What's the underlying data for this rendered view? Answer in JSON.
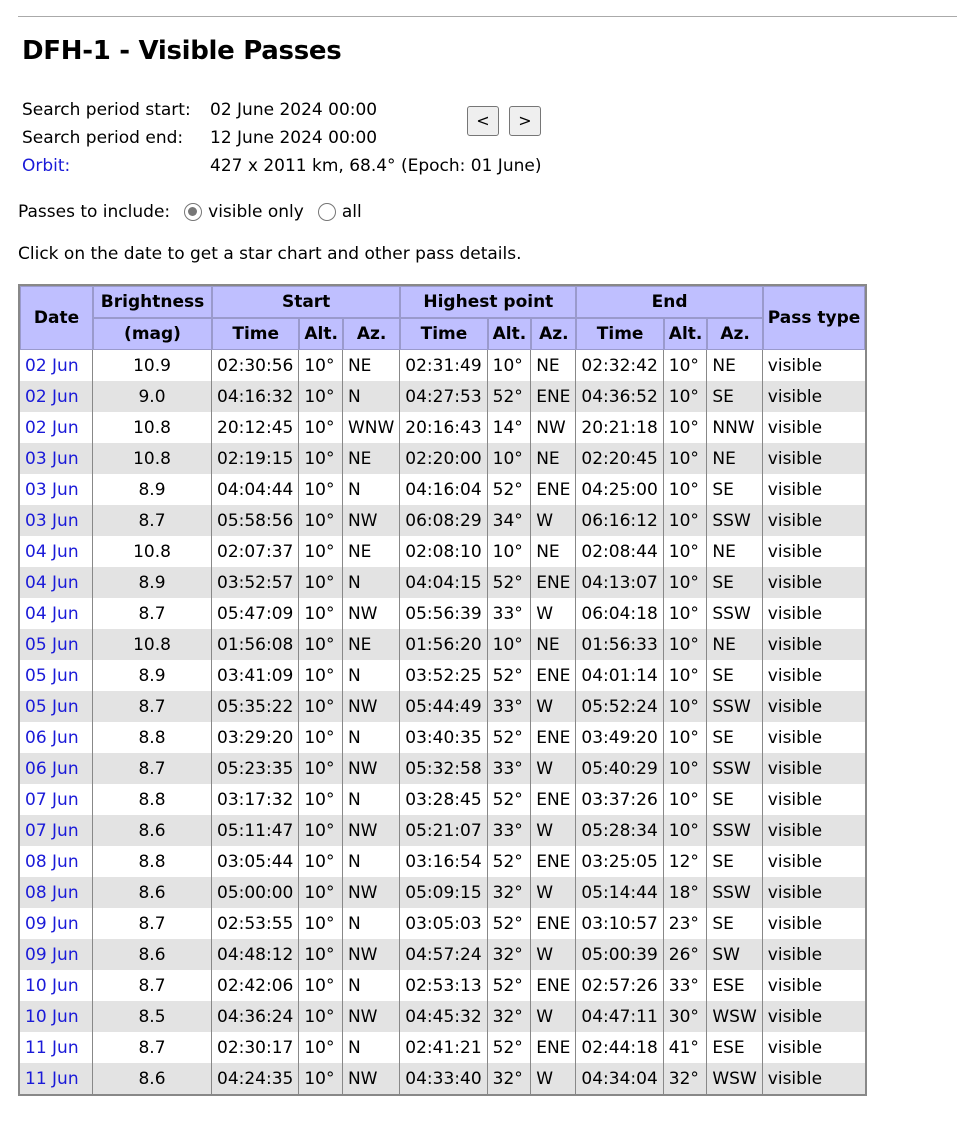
{
  "title": "DFH-1 - Visible Passes",
  "search": {
    "start_label": "Search period start:",
    "start_value": "02 June 2024 00:00",
    "end_label": "Search period end:",
    "end_value": "12 June 2024 00:00",
    "orbit_label": "Orbit:",
    "orbit_value": "427 x 2011 km, 68.4° (Epoch: 01 June)",
    "prev_button": "<",
    "next_button": ">"
  },
  "filter": {
    "label": "Passes to include:",
    "option_visible": "visible only",
    "option_all": "all",
    "selected": "visible only"
  },
  "hint": "Click on the date to get a star chart and other pass details.",
  "table": {
    "headers": {
      "date": "Date",
      "brightness": "Brightness",
      "mag": "(mag)",
      "start": "Start",
      "highest": "Highest point",
      "end": "End",
      "pass_type": "Pass type",
      "time": "Time",
      "alt": "Alt.",
      "az": "Az."
    },
    "rows": [
      [
        "02 Jun",
        "10.9",
        "02:30:56",
        "10°",
        "NE",
        "02:31:49",
        "10°",
        "NE",
        "02:32:42",
        "10°",
        "NE",
        "visible"
      ],
      [
        "02 Jun",
        "9.0",
        "04:16:32",
        "10°",
        "N",
        "04:27:53",
        "52°",
        "ENE",
        "04:36:52",
        "10°",
        "SE",
        "visible"
      ],
      [
        "02 Jun",
        "10.8",
        "20:12:45",
        "10°",
        "WNW",
        "20:16:43",
        "14°",
        "NW",
        "20:21:18",
        "10°",
        "NNW",
        "visible"
      ],
      [
        "03 Jun",
        "10.8",
        "02:19:15",
        "10°",
        "NE",
        "02:20:00",
        "10°",
        "NE",
        "02:20:45",
        "10°",
        "NE",
        "visible"
      ],
      [
        "03 Jun",
        "8.9",
        "04:04:44",
        "10°",
        "N",
        "04:16:04",
        "52°",
        "ENE",
        "04:25:00",
        "10°",
        "SE",
        "visible"
      ],
      [
        "03 Jun",
        "8.7",
        "05:58:56",
        "10°",
        "NW",
        "06:08:29",
        "34°",
        "W",
        "06:16:12",
        "10°",
        "SSW",
        "visible"
      ],
      [
        "04 Jun",
        "10.8",
        "02:07:37",
        "10°",
        "NE",
        "02:08:10",
        "10°",
        "NE",
        "02:08:44",
        "10°",
        "NE",
        "visible"
      ],
      [
        "04 Jun",
        "8.9",
        "03:52:57",
        "10°",
        "N",
        "04:04:15",
        "52°",
        "ENE",
        "04:13:07",
        "10°",
        "SE",
        "visible"
      ],
      [
        "04 Jun",
        "8.7",
        "05:47:09",
        "10°",
        "NW",
        "05:56:39",
        "33°",
        "W",
        "06:04:18",
        "10°",
        "SSW",
        "visible"
      ],
      [
        "05 Jun",
        "10.8",
        "01:56:08",
        "10°",
        "NE",
        "01:56:20",
        "10°",
        "NE",
        "01:56:33",
        "10°",
        "NE",
        "visible"
      ],
      [
        "05 Jun",
        "8.9",
        "03:41:09",
        "10°",
        "N",
        "03:52:25",
        "52°",
        "ENE",
        "04:01:14",
        "10°",
        "SE",
        "visible"
      ],
      [
        "05 Jun",
        "8.7",
        "05:35:22",
        "10°",
        "NW",
        "05:44:49",
        "33°",
        "W",
        "05:52:24",
        "10°",
        "SSW",
        "visible"
      ],
      [
        "06 Jun",
        "8.8",
        "03:29:20",
        "10°",
        "N",
        "03:40:35",
        "52°",
        "ENE",
        "03:49:20",
        "10°",
        "SE",
        "visible"
      ],
      [
        "06 Jun",
        "8.7",
        "05:23:35",
        "10°",
        "NW",
        "05:32:58",
        "33°",
        "W",
        "05:40:29",
        "10°",
        "SSW",
        "visible"
      ],
      [
        "07 Jun",
        "8.8",
        "03:17:32",
        "10°",
        "N",
        "03:28:45",
        "52°",
        "ENE",
        "03:37:26",
        "10°",
        "SE",
        "visible"
      ],
      [
        "07 Jun",
        "8.6",
        "05:11:47",
        "10°",
        "NW",
        "05:21:07",
        "33°",
        "W",
        "05:28:34",
        "10°",
        "SSW",
        "visible"
      ],
      [
        "08 Jun",
        "8.8",
        "03:05:44",
        "10°",
        "N",
        "03:16:54",
        "52°",
        "ENE",
        "03:25:05",
        "12°",
        "SE",
        "visible"
      ],
      [
        "08 Jun",
        "8.6",
        "05:00:00",
        "10°",
        "NW",
        "05:09:15",
        "32°",
        "W",
        "05:14:44",
        "18°",
        "SSW",
        "visible"
      ],
      [
        "09 Jun",
        "8.7",
        "02:53:55",
        "10°",
        "N",
        "03:05:03",
        "52°",
        "ENE",
        "03:10:57",
        "23°",
        "SE",
        "visible"
      ],
      [
        "09 Jun",
        "8.6",
        "04:48:12",
        "10°",
        "NW",
        "04:57:24",
        "32°",
        "W",
        "05:00:39",
        "26°",
        "SW",
        "visible"
      ],
      [
        "10 Jun",
        "8.7",
        "02:42:06",
        "10°",
        "N",
        "02:53:13",
        "52°",
        "ENE",
        "02:57:26",
        "33°",
        "ESE",
        "visible"
      ],
      [
        "10 Jun",
        "8.5",
        "04:36:24",
        "10°",
        "NW",
        "04:45:32",
        "32°",
        "W",
        "04:47:11",
        "30°",
        "WSW",
        "visible"
      ],
      [
        "11 Jun",
        "8.7",
        "02:30:17",
        "10°",
        "N",
        "02:41:21",
        "52°",
        "ENE",
        "02:44:18",
        "41°",
        "ESE",
        "visible"
      ],
      [
        "11 Jun",
        "8.6",
        "04:24:35",
        "10°",
        "NW",
        "04:33:40",
        "32°",
        "W",
        "04:34:04",
        "32°",
        "WSW",
        "visible"
      ]
    ]
  }
}
